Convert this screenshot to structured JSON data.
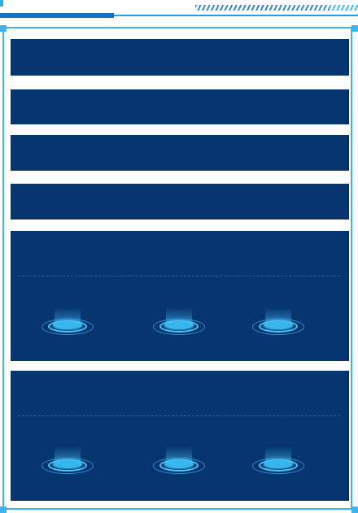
{
  "header": {
    "accent_color": "#1670c6",
    "hatch_color": "#1d6fc4"
  },
  "panels": {
    "background_color": "#06356f",
    "border_color": "#3db3ef",
    "items": [
      {
        "label": ""
      },
      {
        "label": ""
      },
      {
        "label": ""
      },
      {
        "label": ""
      }
    ]
  },
  "stat_panels": [
    {
      "label": "",
      "pedestals": [
        "pedestal-icon",
        "pedestal-icon",
        "pedestal-icon"
      ]
    },
    {
      "label": "",
      "pedestals": [
        "pedestal-icon",
        "pedestal-icon",
        "pedestal-icon"
      ]
    }
  ]
}
